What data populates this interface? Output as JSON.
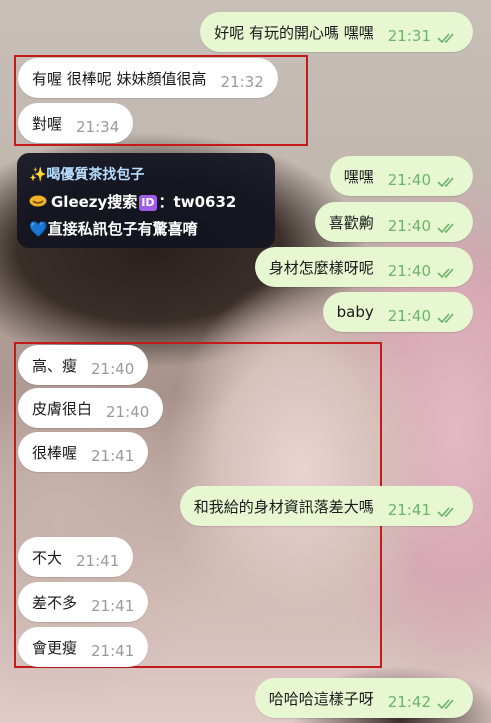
{
  "messages": [
    {
      "text": "好呢 有玩的開心嗎 嘿嘿",
      "time": "21:31"
    },
    {
      "text": "有喔 很棒呢 妹妹顏值很高",
      "time": "21:32"
    },
    {
      "text": "對喔",
      "time": "21:34"
    },
    {
      "text": "嘿嘿",
      "time": "21:40"
    },
    {
      "text": "喜歡齁",
      "time": "21:40"
    },
    {
      "text": "身材怎麼樣呀呢",
      "time": "21:40"
    },
    {
      "text": "baby",
      "time": "21:40"
    },
    {
      "text": "高、瘦",
      "time": "21:40"
    },
    {
      "text": "皮膚很白",
      "time": "21:40"
    },
    {
      "text": "很棒喔",
      "time": "21:41"
    },
    {
      "text": "和我給的身材資訊落差大嗎",
      "time": "21:41"
    },
    {
      "text": "不大",
      "time": "21:41"
    },
    {
      "text": "差不多",
      "time": "21:41"
    },
    {
      "text": "會更瘦",
      "time": "21:41"
    },
    {
      "text": "哈哈哈這樣子呀",
      "time": "21:42"
    }
  ],
  "ad": {
    "line1": "✨喝優質茶找包子",
    "line2_prefix": "Gleezy搜索",
    "line2_badge": "ID",
    "line2_suffix": "：tw0632",
    "line3": "💙直接私訊包子有驚喜唷"
  },
  "colors": {
    "incoming": "#ffffff",
    "outgoing": "#e6f7d2",
    "time_outgoing": "#6db36a",
    "highlight_box": "#c41a1a"
  }
}
